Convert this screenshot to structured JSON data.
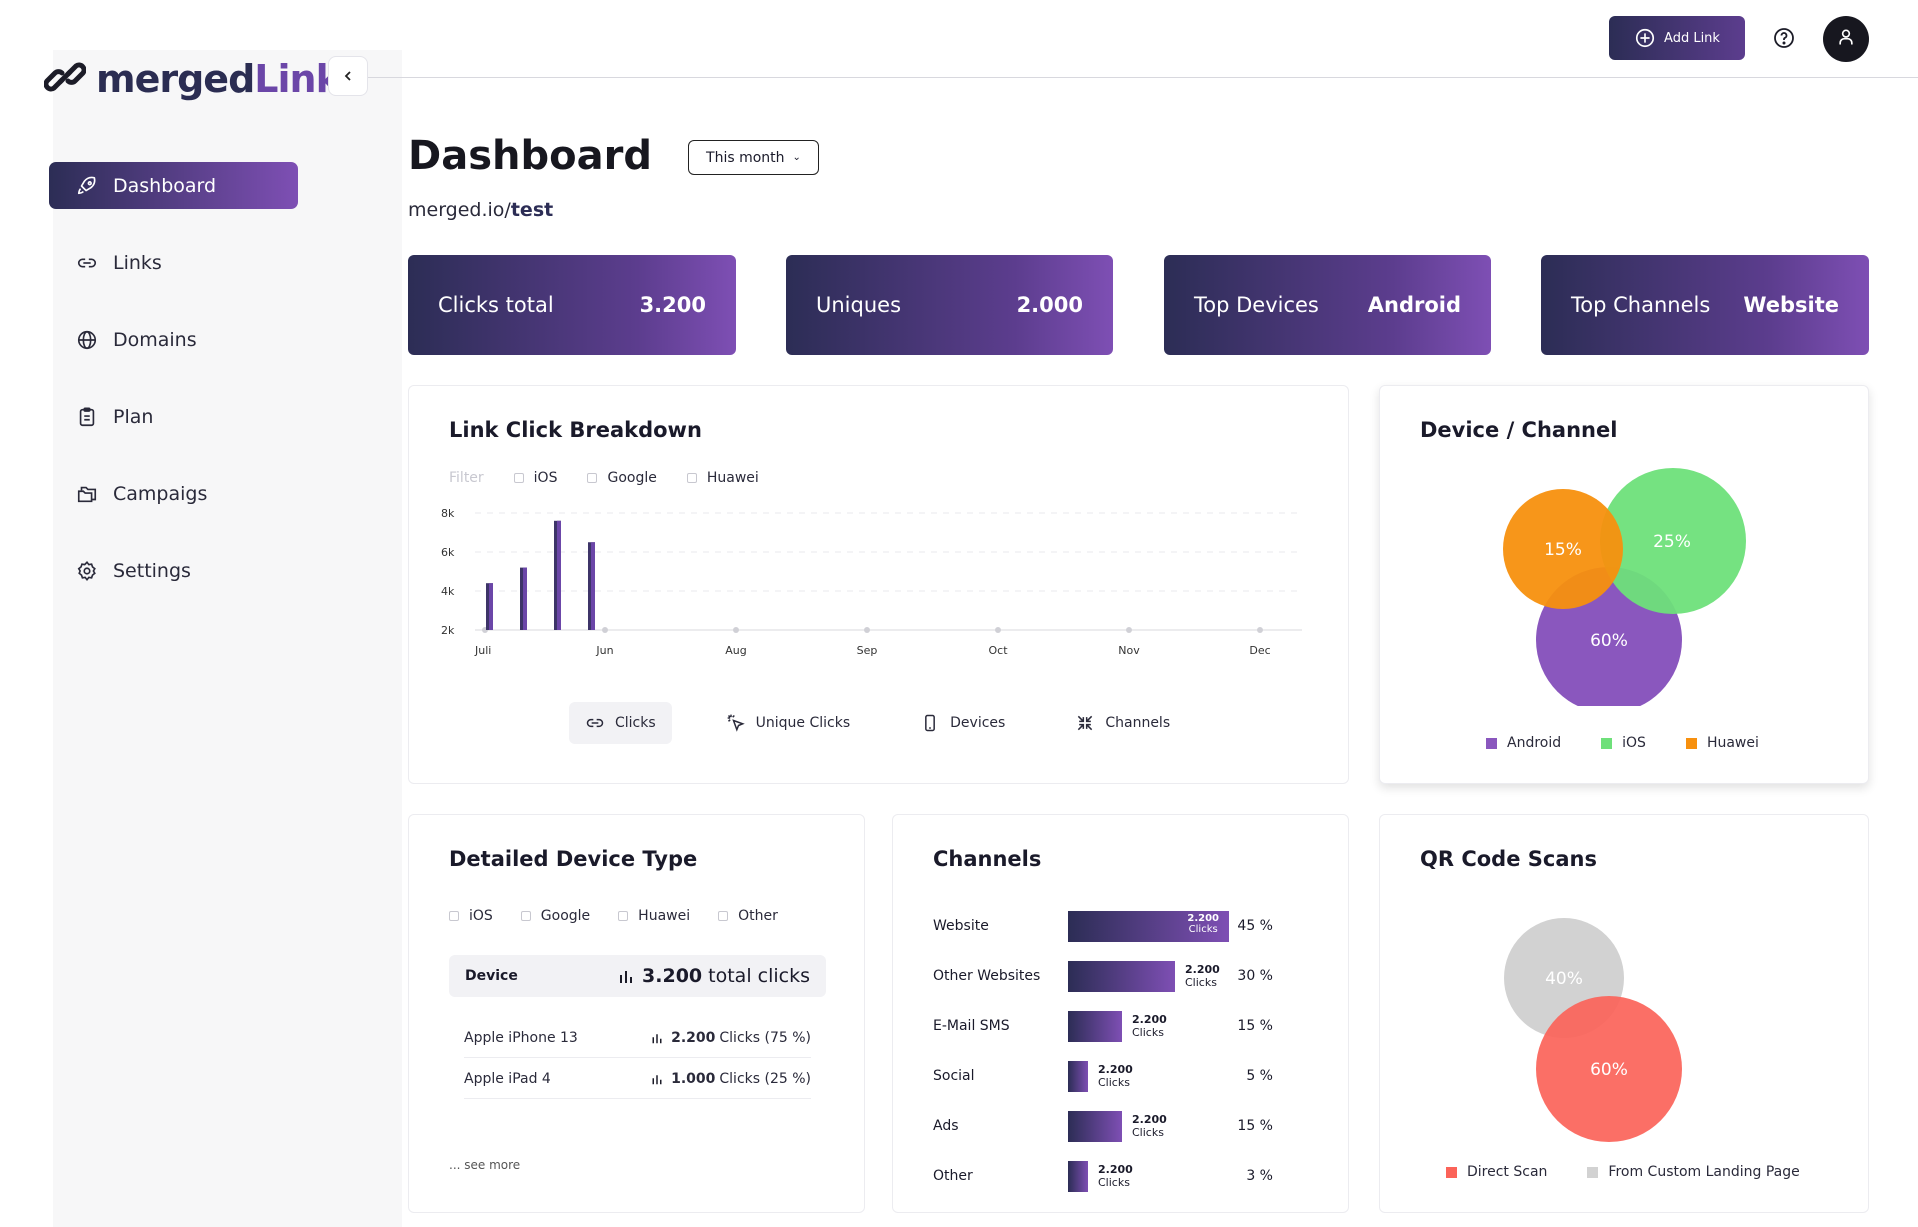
{
  "brand": {
    "name_part1": "merged",
    "name_part2": "Link"
  },
  "colors": {
    "primary_dark": "#2c2d55",
    "primary_purple": "#7e4fb4",
    "android": "#8a57be",
    "ios": "#6ee07a",
    "huawei": "#f7900e",
    "direct_scan": "#fb6359",
    "landing_page": "#d2d2d2"
  },
  "sidebar": {
    "items": [
      {
        "label": "Dashboard",
        "icon": "rocket-icon",
        "active": true
      },
      {
        "label": "Links",
        "icon": "link-icon",
        "active": false
      },
      {
        "label": "Domains",
        "icon": "globe-icon",
        "active": false
      },
      {
        "label": "Plan",
        "icon": "clipboard-icon",
        "active": false
      },
      {
        "label": "Campaigs",
        "icon": "folders-icon",
        "active": false
      },
      {
        "label": "Settings",
        "icon": "gear-icon",
        "active": false
      }
    ]
  },
  "topbar": {
    "add_link_label": "Add Link"
  },
  "header": {
    "title": "Dashboard",
    "period": "This month",
    "link_domain": "merged.io/",
    "link_slug": "test"
  },
  "kpis": [
    {
      "label": "Clicks total",
      "value": "3.200"
    },
    {
      "label": "Uniques",
      "value": "2.000"
    },
    {
      "label": "Top Devices",
      "value": "Android"
    },
    {
      "label": "Top Channels",
      "value": "Website"
    }
  ],
  "breakdown": {
    "title": "Link Click Breakdown",
    "filter_label": "Filter",
    "filters": [
      "iOS",
      "Google",
      "Huawei"
    ],
    "tabs": [
      {
        "label": "Clicks",
        "icon": "link-icon",
        "active": true
      },
      {
        "label": "Unique Clicks",
        "icon": "cursor-click-icon",
        "active": false
      },
      {
        "label": "Devices",
        "icon": "phone-icon",
        "active": false
      },
      {
        "label": "Channels",
        "icon": "compress-icon",
        "active": false
      }
    ]
  },
  "chart_data": {
    "type": "bar",
    "title": "",
    "x_ticks": [
      "Juli",
      "Jun",
      "Aug",
      "Sep",
      "Oct",
      "Nov",
      "Dec"
    ],
    "y_ticks": [
      "2k",
      "4k",
      "6k",
      "8k"
    ],
    "ylim": [
      2000,
      8000
    ],
    "grid": true,
    "series": [
      {
        "values": [
          4400,
          5200,
          7600,
          6500
        ]
      }
    ]
  },
  "device_channel": {
    "title": "Device / Channel",
    "segments": [
      {
        "label": "Android",
        "value": "60%"
      },
      {
        "label": "iOS",
        "value": "25%"
      },
      {
        "label": "Huawei",
        "value": "15%"
      }
    ]
  },
  "device_type": {
    "title": "Detailed Device Type",
    "filters": [
      "iOS",
      "Google",
      "Huawei",
      "Other"
    ],
    "head_label": "Device",
    "head_total": "3.200",
    "head_suffix": "total clicks",
    "rows": [
      {
        "name": "Apple iPhone 13",
        "clicks": "2.200",
        "suffix": "Clicks (75 %)"
      },
      {
        "name": "Apple iPad 4",
        "clicks": "1.000",
        "suffix": "Clicks (25 %)"
      }
    ],
    "see_more": "... see more"
  },
  "channels": {
    "title": "Channels",
    "clicks_word": "Clicks",
    "rows": [
      {
        "name": "Website",
        "clicks": "2.200",
        "pct": "45 %",
        "share": 45
      },
      {
        "name": "Other Websites",
        "clicks": "2.200",
        "pct": "30 %",
        "share": 30
      },
      {
        "name": "E-Mail SMS",
        "clicks": "2.200",
        "pct": "15 %",
        "share": 15
      },
      {
        "name": "Social",
        "clicks": "2.200",
        "pct": "5 %",
        "share": 5
      },
      {
        "name": "Ads",
        "clicks": "2.200",
        "pct": "15 %",
        "share": 15
      },
      {
        "name": "Other",
        "clicks": "2.200",
        "pct": "3 %",
        "share": 3
      }
    ]
  },
  "qr": {
    "title": "QR Code Scans",
    "segments": [
      {
        "label": "From Custom Landing Page",
        "value": "40%"
      },
      {
        "label": "Direct Scan",
        "value": "60%"
      }
    ]
  }
}
